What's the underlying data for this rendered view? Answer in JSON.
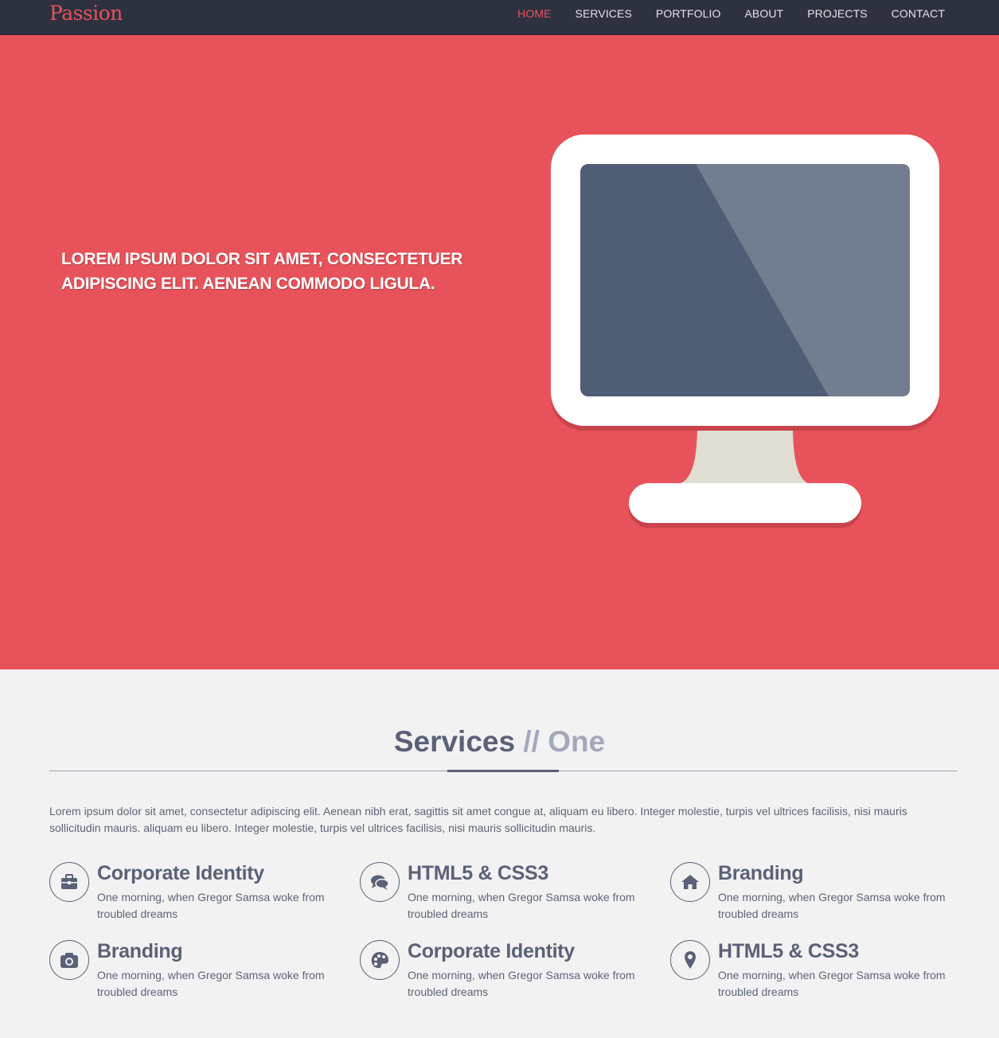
{
  "brand": "Passion",
  "nav": {
    "items": [
      "HOME",
      "SERVICES",
      "PORTFOLIO",
      "ABOUT",
      "PROJECTS",
      "CONTACT"
    ],
    "active": "HOME"
  },
  "hero": {
    "title": "LOREM IPSUM DOLOR SIT AMET, CONSECTETUER ADIPISCING ELIT. AENEAN COMMODO LIGULA."
  },
  "services": {
    "heading": "Services",
    "heading_sub": "// One",
    "intro": "Lorem ipsum dolor sit amet, consectetur adipiscing elit. Aenean nibh erat, sagittis sit amet congue at, aliquam eu libero. Integer molestie, turpis vel ultrices facilisis, nisi mauris sollicitudin mauris. aliquam eu libero. Integer molestie, turpis vel ultrices facilisis, nisi mauris sollicitudin mauris.",
    "items": [
      {
        "title": "Corporate Identity",
        "desc": "One morning, when Gregor Samsa woke from troubled dreams",
        "icon": "briefcase-icon"
      },
      {
        "title": "HTML5 & CSS3",
        "desc": "One morning, when Gregor Samsa woke from troubled dreams",
        "icon": "comments-icon"
      },
      {
        "title": "Branding",
        "desc": "One morning, when Gregor Samsa woke from troubled dreams",
        "icon": "home-icon"
      },
      {
        "title": "Branding",
        "desc": "One morning, when Gregor Samsa woke from troubled dreams",
        "icon": "camera-icon"
      },
      {
        "title": "Corporate Identity",
        "desc": "One morning, when Gregor Samsa woke from troubled dreams",
        "icon": "palette-icon"
      },
      {
        "title": "HTML5 & CSS3",
        "desc": "One morning, when Gregor Samsa woke from troubled dreams",
        "icon": "map-marker-icon"
      }
    ]
  },
  "colors": {
    "accent": "#e8525a",
    "navbar": "#2d3140",
    "text_dark": "#5a6178",
    "background": "#f2f2f2"
  }
}
